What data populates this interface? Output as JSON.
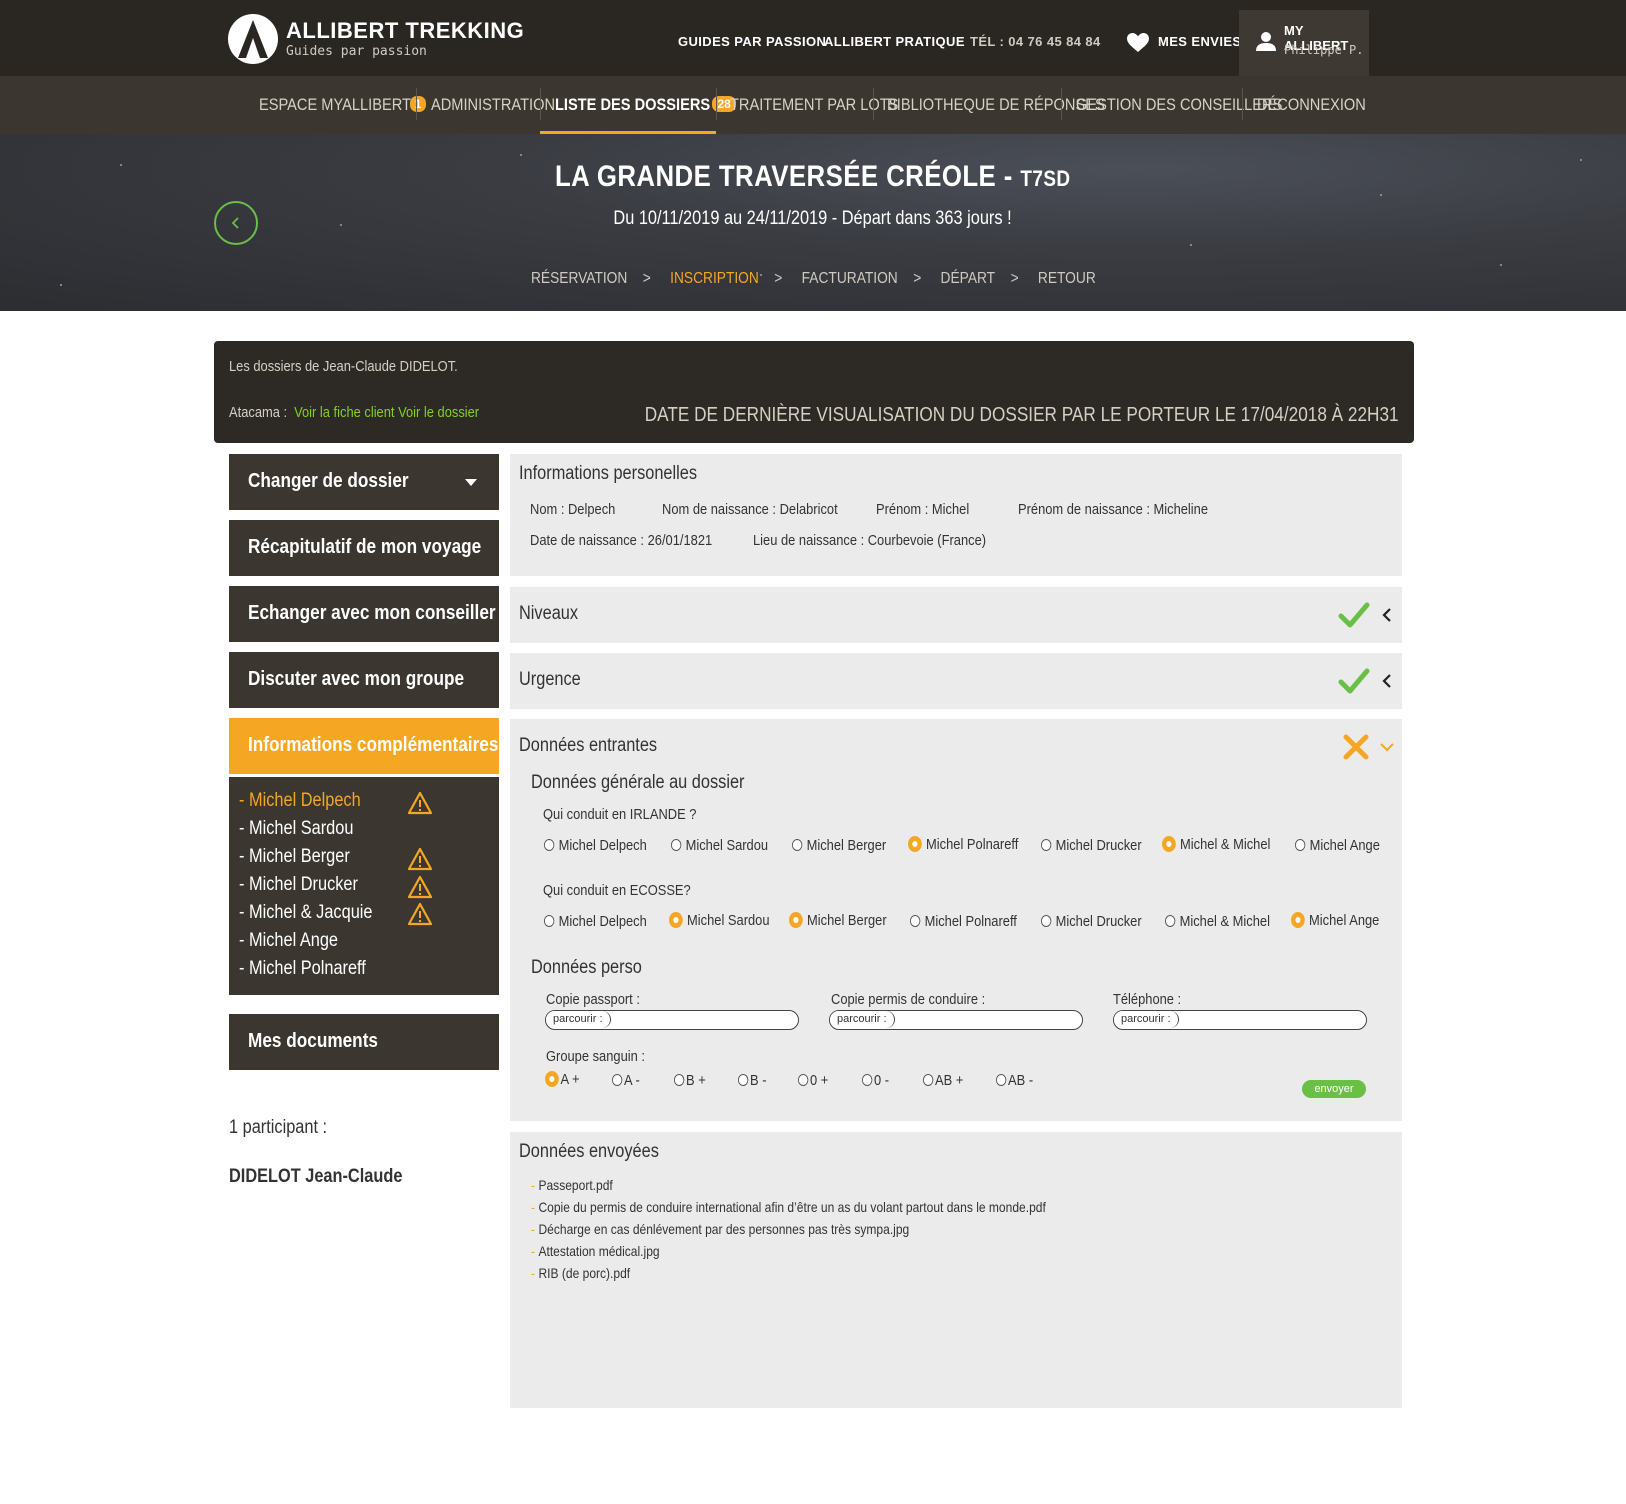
{
  "header": {
    "brand": "ALLIBERT TREKKING",
    "tagline": "Guides par passion",
    "nav": [
      "GUIDES PAR PASSION",
      "ALLIBERT PRATIQUE",
      "TÉL : 04 76 45 84 84",
      "MES ENVIES"
    ],
    "account_title": "MY ALLIBERT",
    "account_user": "Philippe P."
  },
  "subnav": {
    "items": [
      {
        "label": "ESPACE MYALLIBERT",
        "badge": "1"
      },
      {
        "label": "ADMINISTRATION"
      },
      {
        "label": "LISTE DES DOSSIERS",
        "badge": "28"
      },
      {
        "label": "TRAITEMENT PAR LOTS"
      },
      {
        "label": "BIBLIOTHEQUE DE RÉPONSES"
      },
      {
        "label": "GESTION DES CONSEILLERS"
      },
      {
        "label": "DÉCONNEXION"
      }
    ]
  },
  "hero": {
    "title": "LA GRANDE TRAVERSÉE CRÉOLE -",
    "code": "T7SD",
    "subtitle": "Du 10/11/2019 au 24/11/2019 - Départ dans 363 jours !",
    "steps": [
      "RÉSERVATION",
      "INSCRIPTION",
      "FACTURATION",
      "DÉPART",
      "RETOUR"
    ],
    "step_separator": ">"
  },
  "infobar": {
    "owner": "Les dossiers de Jean-Claude DIDELOT.",
    "atacama_label": "Atacama :",
    "link_client": "Voir la fiche client",
    "link_dossier": "Voir le dossier",
    "last_view": "Date de dernière visualisation du dossier par le porteur le 17/04/2018 à 22h31"
  },
  "sidebar": {
    "buttons": [
      "Changer de dossier",
      "Récapitulatif de mon voyage",
      "Echanger avec mon conseiller",
      "Discuter avec mon groupe",
      "Informations complémentaires",
      "Mes documents"
    ],
    "participants": [
      {
        "name": "- Michel Delpech",
        "warning": true
      },
      {
        "name": "- Michel Sardou",
        "warning": false
      },
      {
        "name": "- Michel Berger",
        "warning": true
      },
      {
        "name": "- Michel Drucker",
        "warning": true
      },
      {
        "name": "- Michel & Jacquie",
        "warning": true
      },
      {
        "name": "- Michel Ange",
        "warning": false
      },
      {
        "name": "- Michel Polnareff",
        "warning": false
      }
    ],
    "participant_count": "1 participant :",
    "participant_name": "DIDELOT Jean-Claude"
  },
  "personal": {
    "title": "Informations personelles",
    "nom": "Nom : Delpech",
    "nom_naissance": "Nom de naissance : Delabricot",
    "prenom": "Prénom : Michel",
    "prenom_naissance": "Prénom de naissance : Micheline",
    "date_naissance": "Date de naissance : 26/01/1821",
    "lieu_naissance": "Lieu de naissance : Courbevoie (France)"
  },
  "sections": {
    "niveaux": "Niveaux",
    "urgence": "Urgence",
    "entrantes": "Données entrantes",
    "envoyees": "Données envoyées"
  },
  "entrantes": {
    "general_title": "Données générale au dossier",
    "q1": "Qui conduit en IRLANDE ?",
    "q2": "Qui conduit en ECOSSE?",
    "options": [
      "Michel Delpech",
      "Michel Sardou",
      "Michel Berger",
      "Michel Polnareff",
      "Michel Drucker",
      "Michel & Michel",
      "Michel Ange"
    ],
    "q1_selected": [
      "Michel Polnareff",
      "Michel & Michel"
    ],
    "q2_selected": [
      "Michel Sardou",
      "Michel Berger",
      "Michel Ange"
    ],
    "perso_title": "Données perso",
    "passport_label": "Copie passport :",
    "permis_label": "Copie permis de conduire :",
    "phone_label": "Téléphone :",
    "browse": "parcourir :",
    "blood_label": "Groupe sanguin :",
    "blood_options": [
      "A +",
      "A -",
      "B +",
      "B -",
      "0 +",
      "0 -",
      "AB +",
      "AB -"
    ],
    "blood_selected": "A +",
    "send": "envoyer"
  },
  "envoyees": {
    "files": [
      "Passeport.pdf",
      "Copie du permis de conduire international afin d’être un as du volant partout dans le monde.pdf",
      "Décharge en cas dénlévement par des personnes pas très sympa.jpg",
      "Attestation médical.jpg",
      "RIB (de porc).pdf"
    ]
  },
  "colors": {
    "accent": "#f5a623",
    "green": "#6abf45",
    "link": "#7ed321",
    "dark": "#2a2723",
    "nav": "#3b3730",
    "panel": "#ebebeb"
  }
}
